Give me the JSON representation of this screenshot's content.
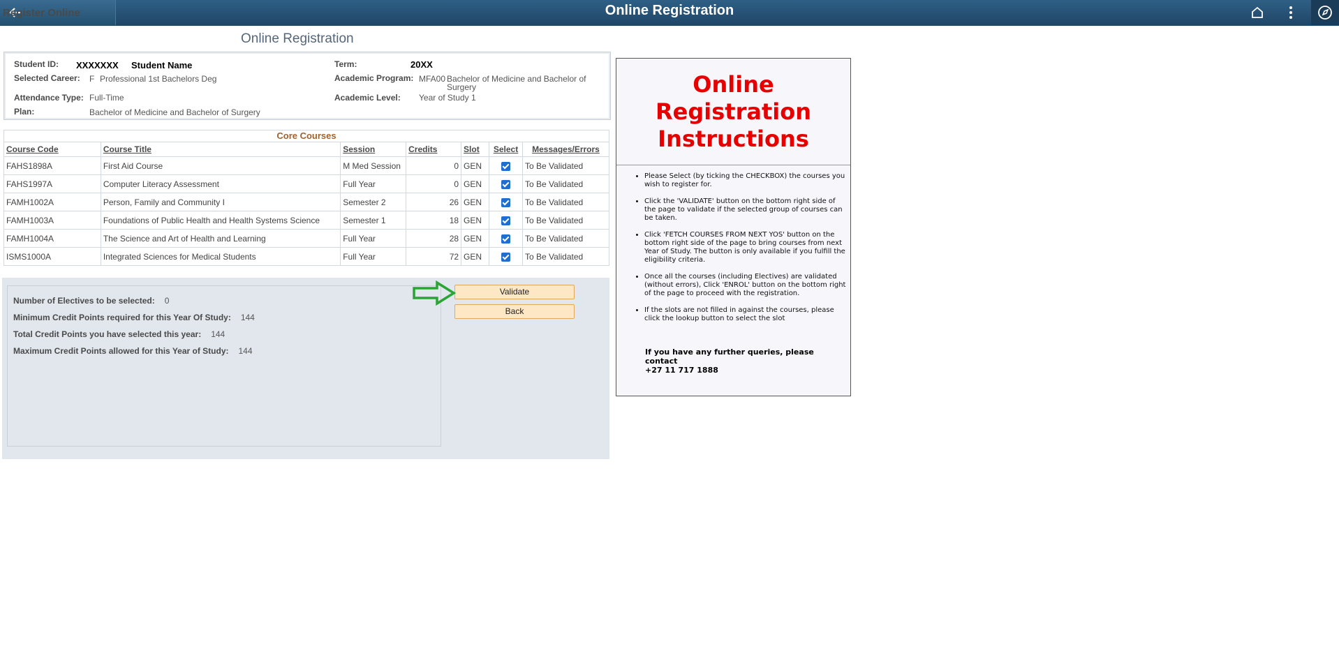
{
  "header": {
    "back_label": "Register Online",
    "title": "Online Registration",
    "icons": [
      "home-icon",
      "more-options-icon",
      "navigator-compass-icon"
    ]
  },
  "page_title": "Online Registration",
  "student": {
    "id_label": "Student ID:",
    "id_value": "XXXXXXX",
    "name_value": "Student Name",
    "term_label": "Term:",
    "term_value": "20XX",
    "career_label": "Selected Career:",
    "career_code": "F",
    "career_value": "Professional 1st Bachelors Deg",
    "program_label": "Academic Program:",
    "program_code": "MFA00",
    "program_value_line1": "Bachelor of Medicine and Bachelor of",
    "program_value_line2": "Surgery",
    "attendance_label": "Attendance Type:",
    "attendance_value": "Full-Time",
    "level_label": "Academic Level:",
    "level_value": "Year of Study 1",
    "plan_label": "Plan:",
    "plan_value": "Bachelor of Medicine and Bachelor of Surgery"
  },
  "core_courses": {
    "caption": "Core Courses",
    "columns": [
      "Course Code",
      "Course Title",
      "Session",
      "Credits",
      "Slot",
      "Select",
      "Messages/Errors"
    ],
    "rows": [
      {
        "code": "FAHS1898A",
        "title": "First Aid Course",
        "session": "M Med Session",
        "credits": "0",
        "slot": "GEN",
        "selected": true,
        "message": "To Be Validated"
      },
      {
        "code": "FAHS1997A",
        "title": "Computer Literacy Assessment",
        "session": "Full Year",
        "credits": "0",
        "slot": "GEN",
        "selected": true,
        "message": "To Be Validated"
      },
      {
        "code": "FAMH1002A",
        "title": "Person, Family and Community I",
        "session": "Semester 2",
        "credits": "26",
        "slot": "GEN",
        "selected": true,
        "message": "To Be Validated"
      },
      {
        "code": "FAMH1003A",
        "title": "Foundations of Public Health and Health Systems Science",
        "session": "Semester 1",
        "credits": "18",
        "slot": "GEN",
        "selected": true,
        "message": "To Be Validated"
      },
      {
        "code": "FAMH1004A",
        "title": "The Science and Art of Health and Learning",
        "session": "Full Year",
        "credits": "28",
        "slot": "GEN",
        "selected": true,
        "message": "To Be Validated"
      },
      {
        "code": "ISMS1000A",
        "title": "Integrated Sciences for Medical Students",
        "session": "Full Year",
        "credits": "72",
        "slot": "GEN",
        "selected": true,
        "message": "To Be Validated"
      }
    ]
  },
  "summary": {
    "electives_label": "Number of Electives to be selected:",
    "electives_value": "0",
    "min_label": "Minimum Credit Points required for this Year Of Study:",
    "min_value": "144",
    "total_label": "Total Credit Points you have selected this year:",
    "total_value": "144",
    "max_label": "Maximum Credit Points allowed for this Year of Study:",
    "max_value": "144"
  },
  "buttons": {
    "validate": "Validate",
    "back": "Back"
  },
  "instructions": {
    "title_line1": "Online",
    "title_line2": "Registration",
    "title_line3": "Instructions",
    "items": [
      "Please Select (by ticking the CHECKBOX) the courses you wish to register for.",
      "Click the 'VALIDATE' button on the bottom right side of the page to validate if the selected group of courses can be taken.",
      "Click 'FETCH COURSES FROM NEXT YOS' button on the bottom right side of the page to bring courses from next Year of Study. The button is only available if you fulfill the eligibility criteria.",
      "Once all the courses (including Electives) are validated (without errors), Click 'ENROL' button on the bottom right of the page to proceed with the registration.",
      "If the slots are not filled in against the courses, please click the lookup button to select the slot"
    ],
    "contact_line1": "If you have any further queries, please contact",
    "contact_line2": "+27 11 717 1888"
  },
  "colors": {
    "header_bg": "#1f4566",
    "instruction_title": "#e60000",
    "caption": "#a2622c",
    "button_bg": "#fde7c4",
    "arrow_green": "#2aa535"
  }
}
